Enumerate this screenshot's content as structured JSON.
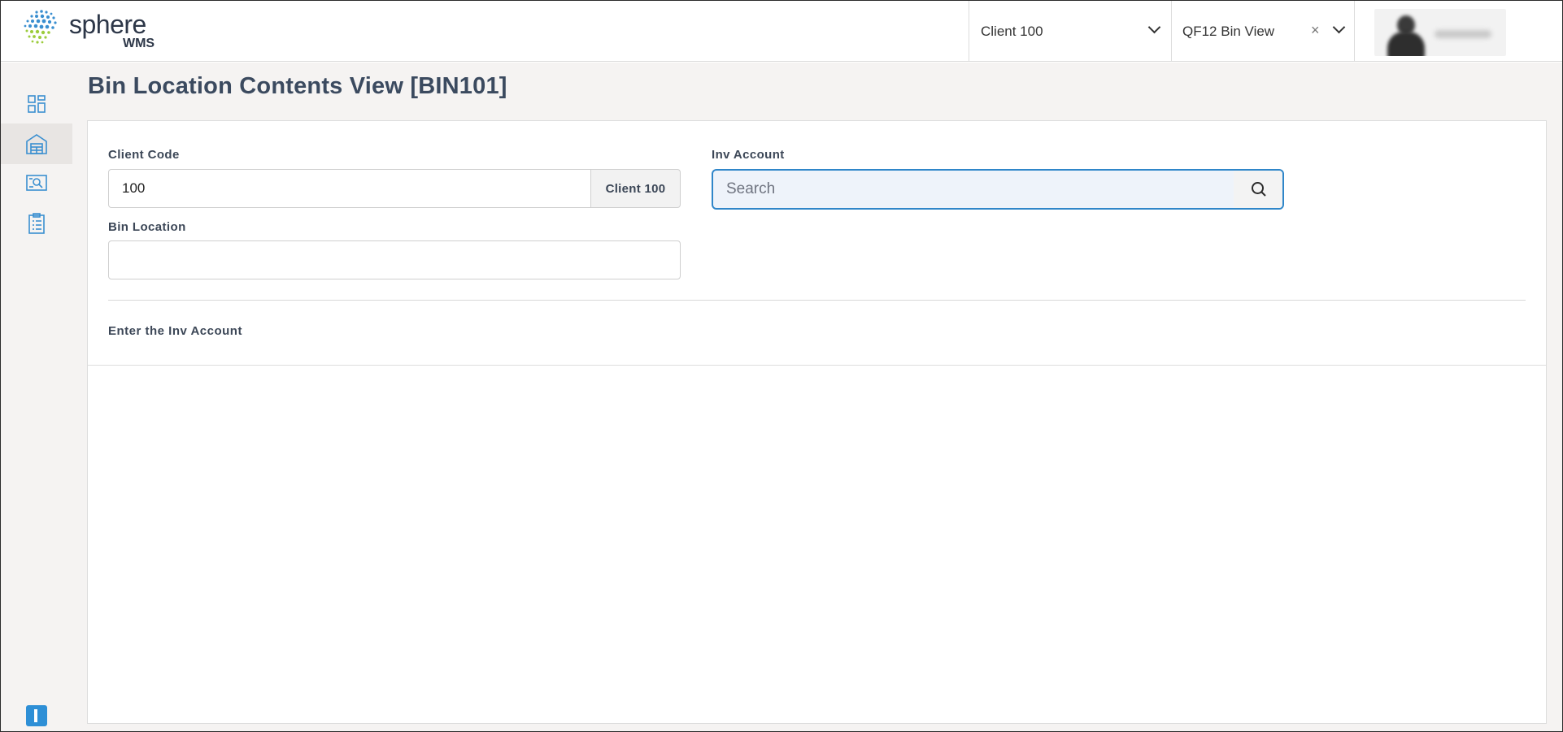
{
  "header": {
    "logo_word": "sphere",
    "logo_sub": "WMS",
    "client_select": {
      "value": "Client 100"
    },
    "view_select": {
      "value": "QF12 Bin View",
      "clear_label": "×"
    }
  },
  "page": {
    "title": "Bin Location Contents View [BIN101]"
  },
  "form": {
    "client_code": {
      "label": "Client Code",
      "value": "100",
      "addon": "Client 100"
    },
    "inv_account": {
      "label": "Inv Account",
      "placeholder": "Search",
      "value": ""
    },
    "bin_location": {
      "label": "Bin Location",
      "value": ""
    },
    "hint": "Enter the Inv Account"
  },
  "sidebar": {
    "items": [
      {
        "icon": "dashboard-icon"
      },
      {
        "icon": "warehouse-icon",
        "active": true
      },
      {
        "icon": "inventory-search-icon"
      },
      {
        "icon": "checklist-icon"
      }
    ],
    "bottom_icon": "panel-toggle-icon"
  },
  "colors": {
    "accent": "#2f86c9",
    "sidebar_bg": "#f5f3f2",
    "title_text": "#3b4a5f"
  }
}
